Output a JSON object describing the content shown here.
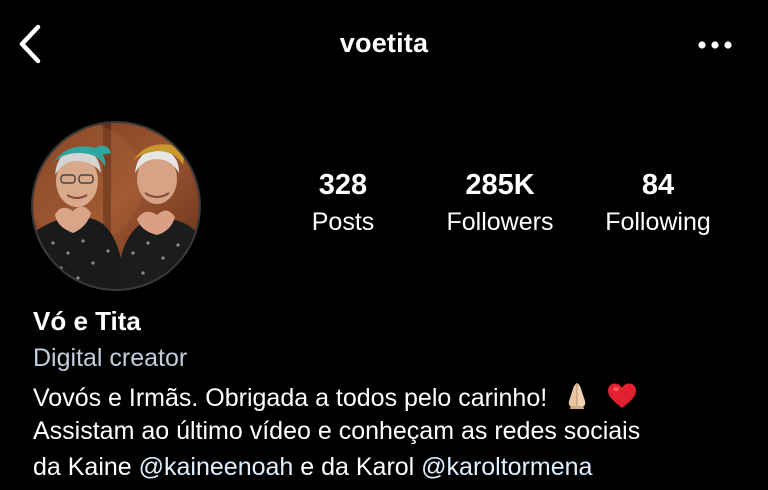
{
  "header": {
    "username": "voetita"
  },
  "profile": {
    "stats": [
      {
        "value": "328",
        "label": "Posts"
      },
      {
        "value": "285K",
        "label": "Followers"
      },
      {
        "value": "84",
        "label": "Following"
      }
    ],
    "display_name": "Vó e Tita",
    "category": "Digital creator",
    "bio": {
      "line1": "Vovós e Irmãs. Obrigada a todos pelo carinho!",
      "line2": "Assistam ao último vídeo e conheçam as redes sociais",
      "line3_prefix": "da Kaine ",
      "mention1": "@kaineenoah",
      "line3_middle": " e da Karol ",
      "mention2": "@karoltormena"
    }
  },
  "icons": {
    "back": "chevron-left-icon",
    "more": "more-horizontal-icon",
    "emoji1": "folded-hands-emoji",
    "emoji2": "red-heart-emoji"
  },
  "colors": {
    "background": "#000000",
    "text": "#ffffff",
    "category": "#c3cddc",
    "mention": "#e0f0ff"
  }
}
